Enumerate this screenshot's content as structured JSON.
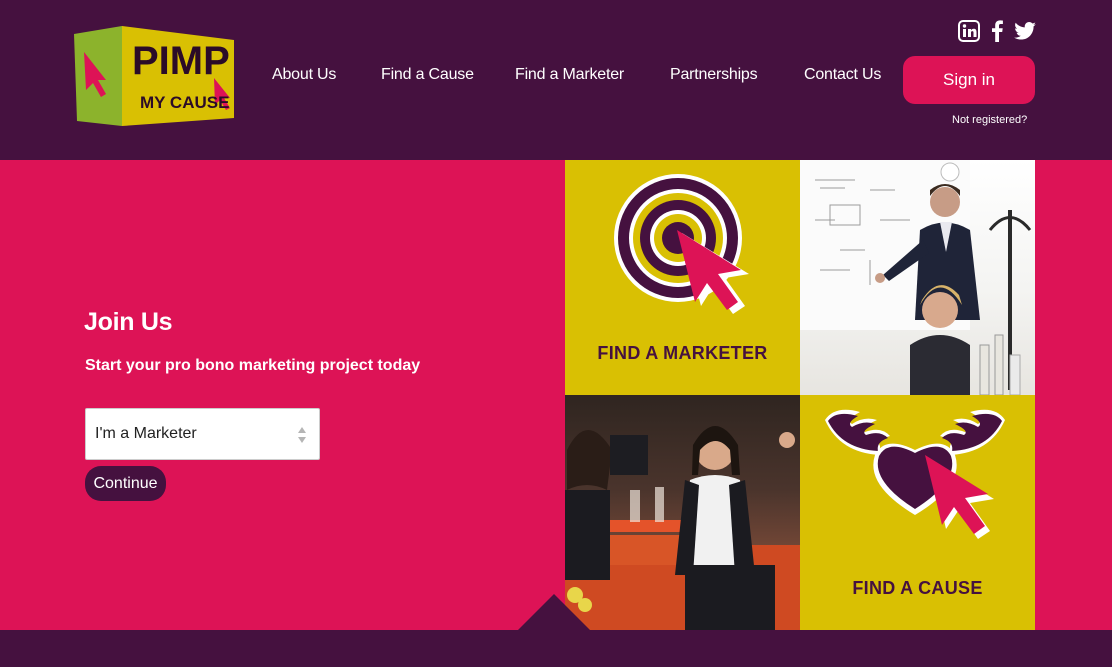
{
  "brand": {
    "logo_line1": "PIMP",
    "logo_line2": "MY CAUSE"
  },
  "nav": {
    "items": [
      {
        "label": "About Us"
      },
      {
        "label": "Find a Cause"
      },
      {
        "label": "Find a Marketer"
      },
      {
        "label": "Partnerships"
      },
      {
        "label": "Contact Us"
      }
    ],
    "sign_in": "Sign in",
    "not_registered": "Not registered?"
  },
  "social": [
    "linkedin-icon",
    "facebook-icon",
    "twitter-icon"
  ],
  "hero": {
    "title": "Join Us",
    "subtitle": "Start your pro bono marketing project today",
    "select_value": "I'm a Marketer",
    "continue_label": "Continue"
  },
  "tiles": {
    "find_marketer": "FIND A MARKETER",
    "find_cause": "FIND A CAUSE"
  },
  "colors": {
    "purple": "#45113f",
    "magenta": "#dd1356",
    "mustard": "#d9c003",
    "logo_green": "#8cb32c"
  }
}
